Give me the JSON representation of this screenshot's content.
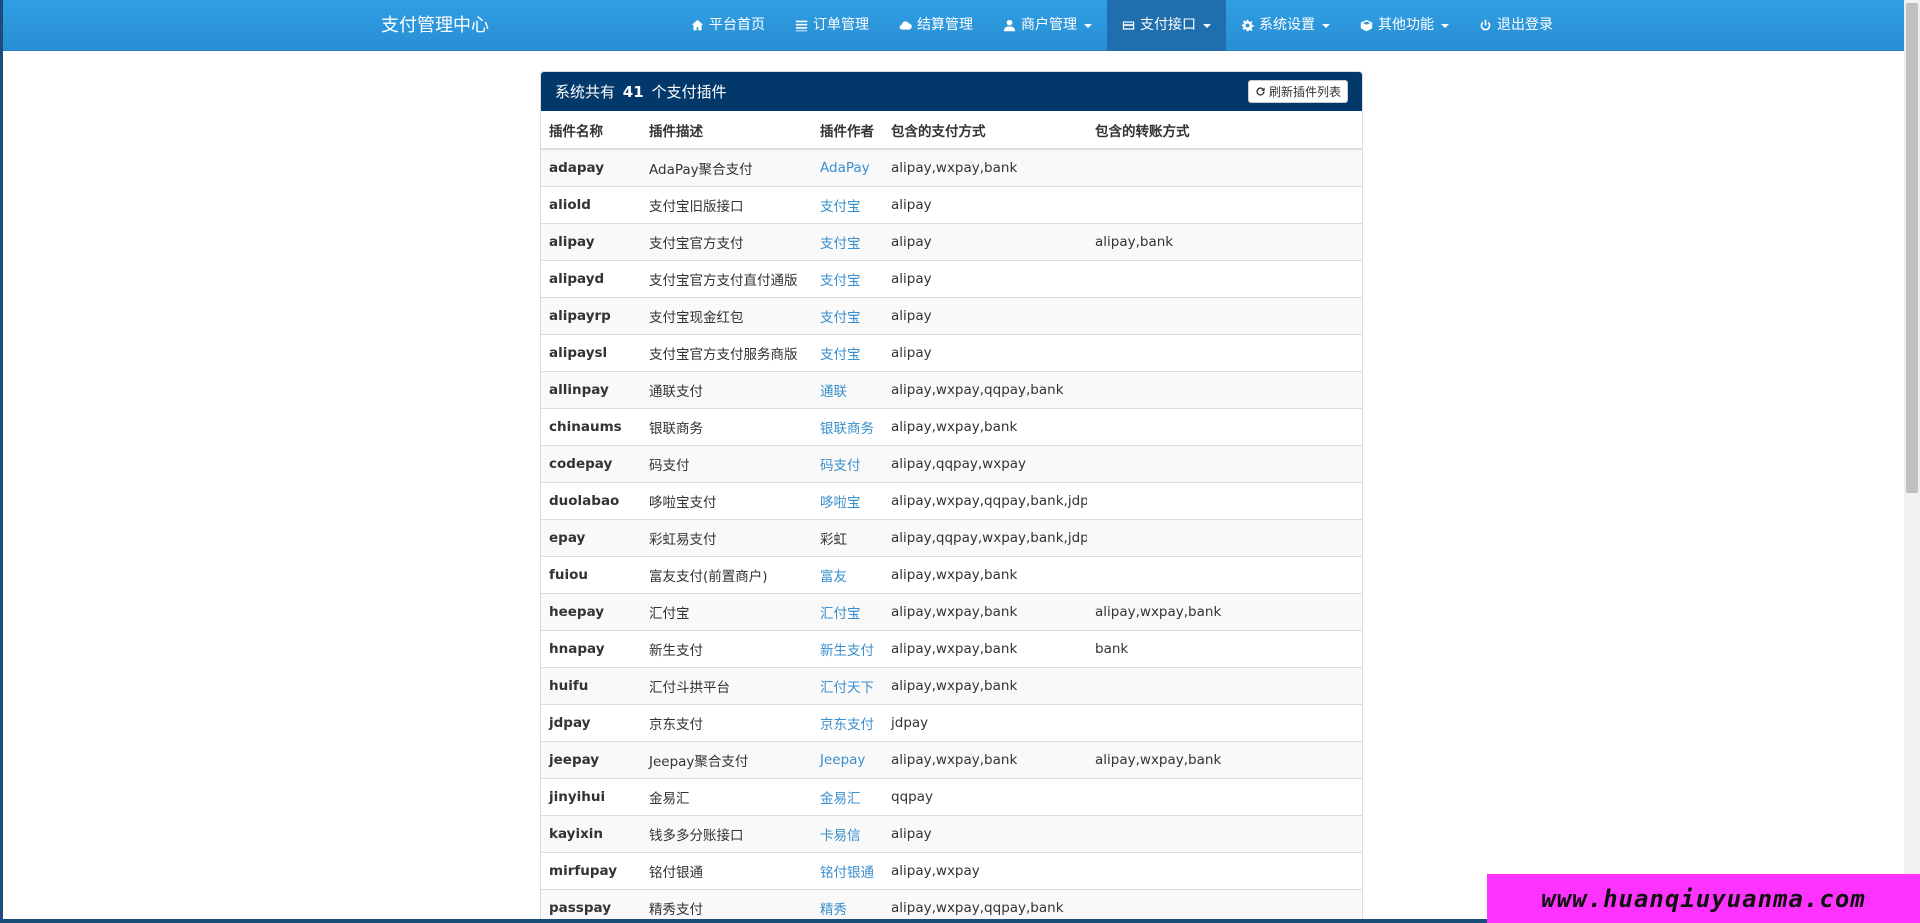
{
  "navbar": {
    "brand": "支付管理中心",
    "items": [
      {
        "label": "平台首页",
        "icon": "home-icon",
        "caret": false,
        "active": false
      },
      {
        "label": "订单管理",
        "icon": "list-icon",
        "caret": false,
        "active": false
      },
      {
        "label": "结算管理",
        "icon": "cloud-icon",
        "caret": false,
        "active": false
      },
      {
        "label": "商户管理",
        "icon": "user-icon",
        "caret": true,
        "active": false
      },
      {
        "label": "支付接口",
        "icon": "credit-card-icon",
        "caret": true,
        "active": true
      },
      {
        "label": "系统设置",
        "icon": "gear-icon",
        "caret": true,
        "active": false
      },
      {
        "label": "其他功能",
        "icon": "cube-icon",
        "caret": true,
        "active": false
      },
      {
        "label": "退出登录",
        "icon": "power-icon",
        "caret": false,
        "active": false
      }
    ]
  },
  "panel": {
    "title_prefix": "系统共有",
    "count": "41",
    "title_suffix": "个支付插件",
    "refresh_label": "刷新插件列表"
  },
  "table": {
    "headers": [
      "插件名称",
      "插件描述",
      "插件作者",
      "包含的支付方式",
      "包含的转账方式"
    ],
    "rows": [
      {
        "name": "adapay",
        "desc": "AdaPay聚合支付",
        "author": "AdaPay",
        "author_link": true,
        "pay": "alipay,wxpay,bank",
        "transfer": ""
      },
      {
        "name": "aliold",
        "desc": "支付宝旧版接口",
        "author": "支付宝",
        "author_link": true,
        "pay": "alipay",
        "transfer": ""
      },
      {
        "name": "alipay",
        "desc": "支付宝官方支付",
        "author": "支付宝",
        "author_link": true,
        "pay": "alipay",
        "transfer": "alipay,bank"
      },
      {
        "name": "alipayd",
        "desc": "支付宝官方支付直付通版",
        "author": "支付宝",
        "author_link": true,
        "pay": "alipay",
        "transfer": ""
      },
      {
        "name": "alipayrp",
        "desc": "支付宝现金红包",
        "author": "支付宝",
        "author_link": true,
        "pay": "alipay",
        "transfer": ""
      },
      {
        "name": "alipaysl",
        "desc": "支付宝官方支付服务商版",
        "author": "支付宝",
        "author_link": true,
        "pay": "alipay",
        "transfer": ""
      },
      {
        "name": "allinpay",
        "desc": "通联支付",
        "author": "通联",
        "author_link": true,
        "pay": "alipay,wxpay,qqpay,bank",
        "transfer": ""
      },
      {
        "name": "chinaums",
        "desc": "银联商务",
        "author": "银联商务",
        "author_link": true,
        "pay": "alipay,wxpay,bank",
        "transfer": ""
      },
      {
        "name": "codepay",
        "desc": "码支付",
        "author": "码支付",
        "author_link": true,
        "pay": "alipay,qqpay,wxpay",
        "transfer": ""
      },
      {
        "name": "duolabao",
        "desc": "哆啦宝支付",
        "author": "哆啦宝",
        "author_link": true,
        "pay": "alipay,wxpay,qqpay,bank,jdpay",
        "transfer": ""
      },
      {
        "name": "epay",
        "desc": "彩虹易支付",
        "author": "彩虹",
        "author_link": false,
        "pay": "alipay,qqpay,wxpay,bank,jdpay",
        "transfer": ""
      },
      {
        "name": "fuiou",
        "desc": "富友支付(前置商户)",
        "author": "富友",
        "author_link": true,
        "pay": "alipay,wxpay,bank",
        "transfer": ""
      },
      {
        "name": "heepay",
        "desc": "汇付宝",
        "author": "汇付宝",
        "author_link": true,
        "pay": "alipay,wxpay,bank",
        "transfer": "alipay,wxpay,bank"
      },
      {
        "name": "hnapay",
        "desc": "新生支付",
        "author": "新生支付",
        "author_link": true,
        "pay": "alipay,wxpay,bank",
        "transfer": "bank"
      },
      {
        "name": "huifu",
        "desc": "汇付斗拱平台",
        "author": "汇付天下",
        "author_link": true,
        "pay": "alipay,wxpay,bank",
        "transfer": ""
      },
      {
        "name": "jdpay",
        "desc": "京东支付",
        "author": "京东支付",
        "author_link": true,
        "pay": "jdpay",
        "transfer": ""
      },
      {
        "name": "jeepay",
        "desc": "Jeepay聚合支付",
        "author": "Jeepay",
        "author_link": true,
        "pay": "alipay,wxpay,bank",
        "transfer": "alipay,wxpay,bank"
      },
      {
        "name": "jinyihui",
        "desc": "金易汇",
        "author": "金易汇",
        "author_link": true,
        "pay": "qqpay",
        "transfer": ""
      },
      {
        "name": "kayixin",
        "desc": "钱多多分账接口",
        "author": "卡易信",
        "author_link": true,
        "pay": "alipay",
        "transfer": ""
      },
      {
        "name": "mirfupay",
        "desc": "铭付银通",
        "author": "铭付银通",
        "author_link": true,
        "pay": "alipay,wxpay",
        "transfer": ""
      },
      {
        "name": "passpay",
        "desc": "精秀支付",
        "author": "精秀",
        "author_link": true,
        "pay": "alipay,wxpay,qqpay,bank",
        "transfer": ""
      }
    ]
  },
  "watermark": "www.huanqiuyuanma.com",
  "colors": {
    "navbar": "#2f9ee3",
    "nav_active": "#1f6fae",
    "panel_heading": "#03386b",
    "link": "#3a8fcd",
    "watermark_bg": "#ff33ff"
  }
}
